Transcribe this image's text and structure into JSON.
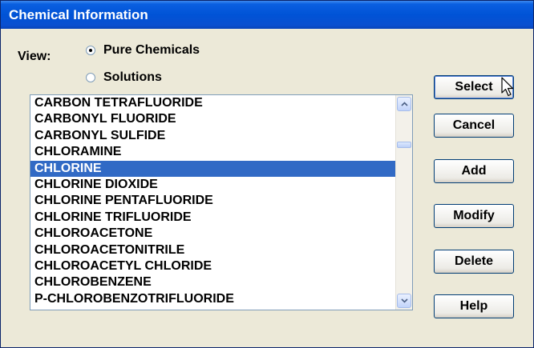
{
  "window": {
    "title": "Chemical Information"
  },
  "view": {
    "label": "View:",
    "options": [
      {
        "label": "Pure Chemicals",
        "checked": true
      },
      {
        "label": "Solutions",
        "checked": false
      }
    ]
  },
  "list": {
    "items": [
      "CARBON TETRAFLUORIDE",
      "CARBONYL FLUORIDE",
      "CARBONYL SULFIDE",
      "CHLORAMINE",
      "CHLORINE",
      "CHLORINE DIOXIDE",
      "CHLORINE PENTAFLUORIDE",
      "CHLORINE TRIFLUORIDE",
      "CHLOROACETONE",
      "CHLOROACETONITRILE",
      "CHLOROACETYL CHLORIDE",
      "CHLOROBENZENE",
      "P-CHLOROBENZOTRIFLUORIDE"
    ],
    "selected_index": 4
  },
  "buttons": {
    "select": "Select",
    "cancel": "Cancel",
    "add": "Add",
    "modify": "Modify",
    "delete": "Delete",
    "help": "Help"
  },
  "icons": {
    "scroll_up": "chevron-up-icon",
    "scroll_down": "chevron-down-icon",
    "cursor": "mouse-pointer-icon"
  },
  "colors": {
    "titlebar": "#0053d6",
    "selection": "#316ac5",
    "dialog_bg": "#ece9d8"
  }
}
